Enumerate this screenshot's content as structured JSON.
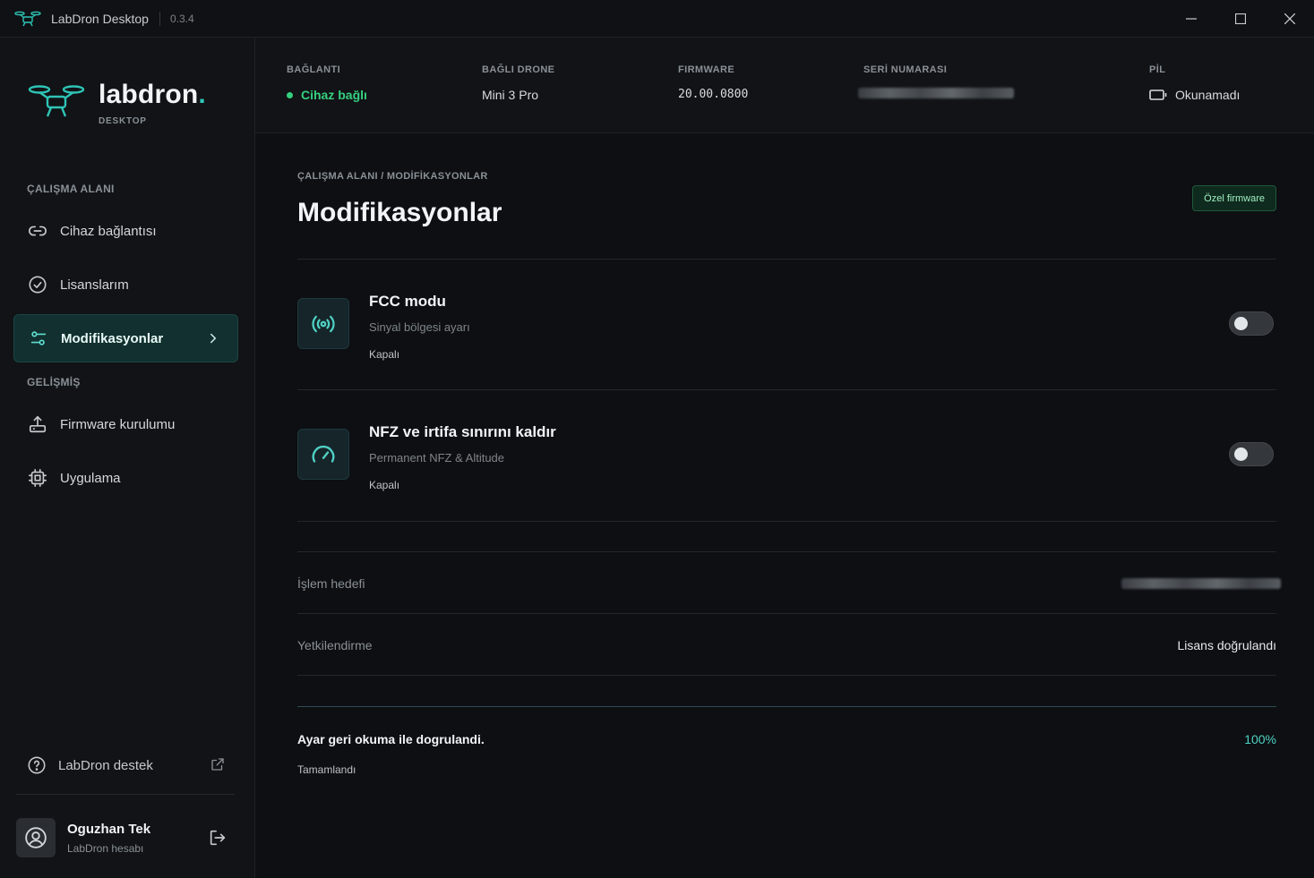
{
  "app": {
    "title": "LabDron Desktop",
    "version": "0.3.4"
  },
  "brand": {
    "name": "labdron",
    "dot": ".",
    "sub": "DESKTOP"
  },
  "sidebar": {
    "section_workspace": "ÇALIŞMA ALANI",
    "section_advanced": "GELİŞMİŞ",
    "items": [
      {
        "label": "Cihaz bağlantısı",
        "icon": "link-icon"
      },
      {
        "label": "Lisanslarım",
        "icon": "check-circle-icon"
      },
      {
        "label": "Modifikasyonlar",
        "icon": "sliders-icon",
        "active": true
      },
      {
        "label": "Firmware kurulumu",
        "icon": "upload-icon"
      },
      {
        "label": "Uygulama",
        "icon": "chip-icon"
      }
    ],
    "support_label": "LabDron destek",
    "user": {
      "name": "Oguzhan Tek",
      "sub": "LabDron hesabı"
    }
  },
  "status": {
    "connection_label": "BAĞLANTI",
    "connection_value": "Cihaz bağlı",
    "drone_label": "BAĞLI DRONE",
    "drone_value": "Mini 3 Pro",
    "firmware_label": "FIRMWARE",
    "firmware_value": "20.00.0800",
    "serial_label": "SERİ NUMARASI",
    "battery_label": "PİL",
    "battery_value": "Okunamadı"
  },
  "main": {
    "breadcrumb": "ÇALIŞMA ALANI / MODİFİKASYONLAR",
    "title": "Modifikasyonlar",
    "badge": "Özel firmware",
    "mods": [
      {
        "title": "FCC modu",
        "sub": "Sinyal bölgesi ayarı",
        "state": "Kapalı",
        "enabled": false
      },
      {
        "title": "NFZ ve irtifa sınırını kaldır",
        "sub": "Permanent NFZ & Altitude",
        "state": "Kapalı",
        "enabled": false
      }
    ],
    "info": {
      "target_label": "İşlem hedefi",
      "auth_label": "Yetkilendirme",
      "auth_value": "Lisans doğrulandı"
    },
    "progress": {
      "text": "Ayar geri okuma ile dogrulandi.",
      "percent": "100%",
      "state": "Tamamlandı"
    }
  },
  "colors": {
    "accent": "#2ec4b6",
    "success": "#35d07f",
    "background": "#0d0f12"
  }
}
